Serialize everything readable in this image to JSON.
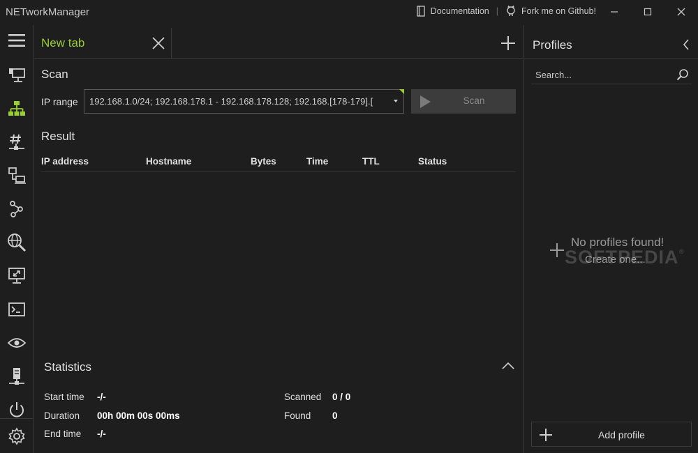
{
  "app": {
    "title": "NETworkManager"
  },
  "titlebar": {
    "documentation": "Documentation",
    "separator": "|",
    "github": "Fork me on Github!"
  },
  "tabs": [
    {
      "label": "New tab"
    }
  ],
  "scan": {
    "heading": "Scan",
    "ip_range_label": "IP range",
    "ip_range_value": "192.168.1.0/24; 192.168.178.1 - 192.168.178.128; 192.168.[178-179].[",
    "scan_button": "Scan"
  },
  "result": {
    "heading": "Result",
    "columns": [
      "IP address",
      "Hostname",
      "Bytes",
      "Time",
      "TTL",
      "Status"
    ]
  },
  "statistics": {
    "heading": "Statistics",
    "start_time_label": "Start time",
    "start_time_value": "-/-",
    "duration_label": "Duration",
    "duration_value": "00h 00m 00s 00ms",
    "end_time_label": "End time",
    "end_time_value": "-/-",
    "scanned_label": "Scanned",
    "scanned_value": "0 / 0",
    "found_label": "Found",
    "found_value": "0"
  },
  "profiles": {
    "title": "Profiles",
    "search_placeholder": "Search...",
    "empty_title": "No profiles found!",
    "empty_link": "Create one...",
    "add_button": "Add profile"
  },
  "watermark": {
    "text": "SOFTPEDIA",
    "reg": "®"
  },
  "colors": {
    "accent": "#9acd32",
    "background": "#1e1e1e",
    "border": "#3a3a3a"
  },
  "icons": {
    "nav": [
      "hamburger-menu-icon",
      "network-interface-icon",
      "ip-scanner-icon",
      "port-scanner-icon",
      "ping-icon",
      "traceroute-icon",
      "dns-lookup-icon",
      "remote-desktop-icon",
      "terminal-icon",
      "lookup-icon",
      "server-icon",
      "wake-on-lan-icon",
      "settings-gear-icon"
    ]
  }
}
